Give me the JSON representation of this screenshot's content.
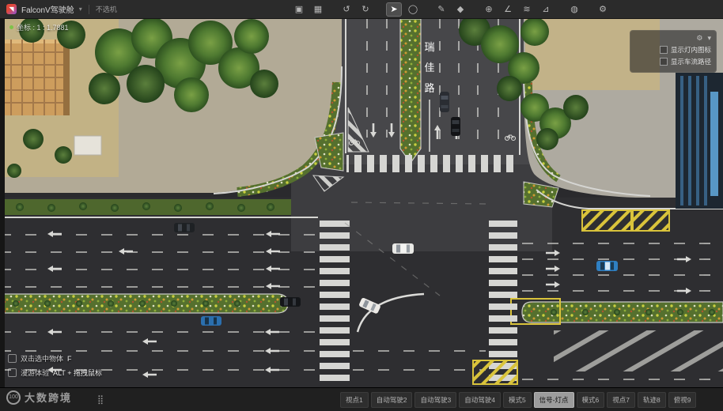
{
  "top_bar": {
    "title": "FalconV驾驶舱",
    "title_caret": "▾",
    "mode": "不选机",
    "tools": [
      {
        "name": "duplicate",
        "glyph": "▣"
      },
      {
        "name": "save",
        "glyph": "▦"
      },
      {
        "name": "undo",
        "glyph": "↺"
      },
      {
        "name": "redo",
        "glyph": "↻"
      },
      {
        "name": "select",
        "glyph": "➤"
      },
      {
        "name": "circle-select",
        "glyph": "◯"
      },
      {
        "name": "pen",
        "glyph": "✎"
      },
      {
        "name": "fill",
        "glyph": "◆"
      },
      {
        "name": "measure-point",
        "glyph": "⊕"
      },
      {
        "name": "measure-angle",
        "glyph": "∠"
      },
      {
        "name": "measure-path",
        "glyph": "≋"
      },
      {
        "name": "measure-area",
        "glyph": "⊿"
      },
      {
        "name": "voice",
        "glyph": "◍"
      },
      {
        "name": "settings",
        "glyph": "⚙"
      }
    ]
  },
  "viewport": {
    "coords": "坐标 : 1 : 1.7881",
    "panel": {
      "gear": "⚙",
      "caret": "▾",
      "options": [
        "显示灯内图标",
        "显示车流路径"
      ]
    },
    "hints": [
      {
        "label": "双击选中物体",
        "key": "F"
      },
      {
        "label": "漫游体验",
        "key": "ALT + 拖拽鼠标"
      }
    ],
    "watermark": {
      "badge": "100",
      "text": "大数跨境"
    }
  },
  "scene": {
    "road_name": "瑞佳路",
    "road_name_chars": [
      "瑞",
      "佳",
      "路"
    ]
  },
  "bottom_bar": {
    "grid_icon": "⣿",
    "tabs": [
      {
        "label": "视点1"
      },
      {
        "label": "自动驾驶2"
      },
      {
        "label": "自动驾驶3"
      },
      {
        "label": "自动驾驶4"
      },
      {
        "label": "模式5"
      },
      {
        "label": "信号-灯点"
      },
      {
        "label": "模式6"
      },
      {
        "label": "视点7"
      },
      {
        "label": "轨迹8"
      },
      {
        "label": "俯视9"
      }
    ],
    "active_tab": "信号-灯点"
  }
}
